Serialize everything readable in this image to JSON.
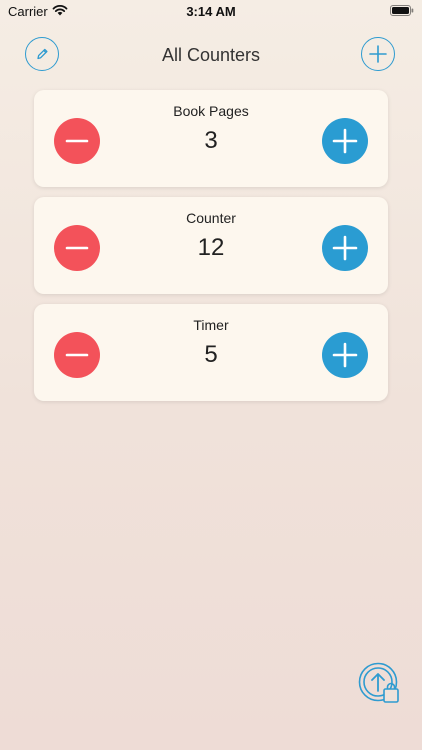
{
  "status_bar": {
    "carrier": "Carrier",
    "time": "3:14 AM",
    "wifi_icon": "wifi-icon",
    "battery_icon": "battery-icon"
  },
  "header": {
    "title": "All Counters",
    "left_icon": "pencil-icon",
    "right_icon": "plus-icon"
  },
  "counters": [
    {
      "name": "Book Pages",
      "value": "3"
    },
    {
      "name": "Counter",
      "value": "12"
    },
    {
      "name": "Timer",
      "value": "5"
    }
  ],
  "controls": {
    "minus_icon": "minus-icon",
    "plus_icon": "plus-icon"
  },
  "colors": {
    "accent": "#2e9bd0",
    "minus": "#f3525a",
    "plus": "#2a9cd2",
    "card": "#fdf7ee"
  },
  "footer": {
    "store_icon": "upload-shopping-bag-icon"
  }
}
